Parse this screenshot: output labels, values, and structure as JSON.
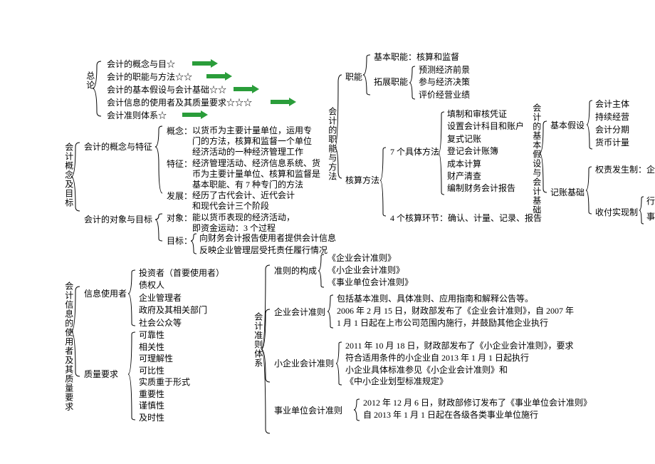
{
  "section1": {
    "title": "总论",
    "items": [
      "会计的概念与目☆",
      "会计的职能与方法☆☆",
      "会计的基本假设与会计基础☆☆",
      "会计信息的使用者及其质量要求☆☆☆",
      "会计准则体系☆"
    ]
  },
  "section2": {
    "title": "会计概念及目标",
    "c1": {
      "title": "会计的概念与特征",
      "k1": {
        "label": "概念：",
        "text": [
          "以货币为主要计量单位，运用专",
          "门的方法，核算和监督一个单位",
          "经济活动的一种经济管理工作"
        ]
      },
      "k2": {
        "label": "特征：",
        "text": [
          "经济管理活动、经济信息系统、货",
          "币为主要计量单位、核算和监督是",
          "基本职能、有 7 种专门的方法"
        ]
      },
      "k3": {
        "label": "发展：",
        "text": [
          "经历了古代会计、近代会计",
          "和现代会计三个阶段"
        ]
      }
    },
    "c2": {
      "title": "会计的对象与目标",
      "k1": {
        "label": "对象：",
        "text": [
          "能以货币表现的经济活动，",
          "即资金运动：3 个过程"
        ]
      },
      "k2": {
        "label": "目标：",
        "text": [
          "向财务会计报告使用者提供会计信息",
          "反映企业管理层受托责任履行情况"
        ]
      }
    }
  },
  "section3": {
    "title": "会计的职能与方法",
    "p1": {
      "title": "职能",
      "a": {
        "label": "基本职能：",
        "val": "核算和监督"
      },
      "b": {
        "label": "拓展职能",
        "items": [
          "预测经济前景",
          "参与经济决策",
          "评价经营业绩"
        ]
      }
    },
    "p2": {
      "title": "核算方法",
      "a": {
        "label": "7 个具体方法",
        "items": [
          "填制和审核凭证",
          "设置会计科目和账户",
          "复式记账",
          "登记会计账簿",
          "成本计算",
          "财产清查",
          "编制财务会计报告"
        ]
      },
      "b": "4 个核算环节：确认、计量、记录、报告"
    }
  },
  "section4": {
    "title": "会计的基本假设与会计基础",
    "a": {
      "label": "基本假设",
      "items": [
        "会计主体",
        "持续经营",
        "会计分期",
        "货币计量"
      ]
    },
    "b": {
      "label": "记账基础",
      "x": {
        "label": "权责发生制：",
        "val": "企业用"
      },
      "y": {
        "label": "收付实现制",
        "items": [
          "行政单位",
          "事业单位的非盈利性业务"
        ]
      }
    }
  },
  "section5": {
    "title": "会计信息的使用者及其质量要求",
    "u": {
      "label": "信息使用者",
      "items": [
        "投资者（首要使用者）",
        "债权人",
        "企业管理者",
        "政府及其相关部门",
        "社会公众等"
      ]
    },
    "q": {
      "label": "质量要求",
      "items": [
        "可靠性",
        "相关性",
        "可理解性",
        "可比性",
        "实质重于形式",
        "重要性",
        "谨慎性",
        "及时性"
      ]
    }
  },
  "section6": {
    "title": "会计准则体系",
    "a": {
      "label": "准则的构成",
      "items": [
        "《企业会计准则》",
        "《小企业会计准则》",
        "《事业单位会计准则》"
      ]
    },
    "b": {
      "label": "企业会计准则",
      "items": [
        "包括基本准则、具体准则、应用指南和解释公告等。",
        "2006 年 2 月 15 日，财政部发布了《企业会计准则》，自 2007 年",
        "1 月 1 日起在上市公司范围内施行，并鼓励其他企业执行"
      ]
    },
    "c": {
      "label": "小企业会计准则",
      "items": [
        "2011 年 10 月 18 日，财政部发布了《小企业会计准则》，要求",
        "符合适用条件的小企业自 2013 年 1 月 1 日起执行",
        "小企业具体标准参见《小企业会计准则》和",
        "《中小企业划型标准规定》"
      ]
    },
    "d": {
      "label": "事业单位会计准则",
      "items": [
        "2012 年 12 月 6 日，财政部修订发布了《事业单位会计准则》",
        "自 2013 年 1 月 1 日起在各级各类事业单位施行"
      ]
    }
  }
}
